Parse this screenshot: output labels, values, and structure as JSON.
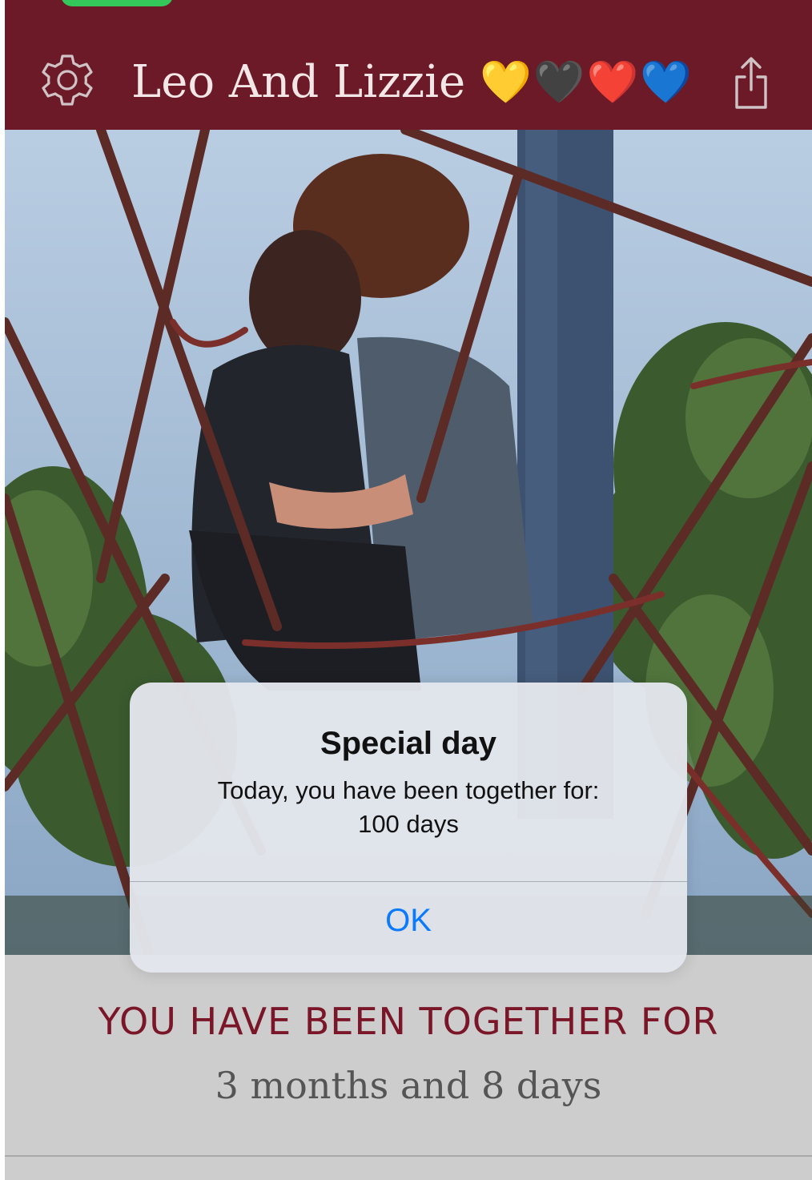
{
  "header": {
    "title": "Leo And Lizzie",
    "hearts": "💛🖤❤️💙",
    "left_icon": "gear-icon",
    "right_icon": "share-icon",
    "background_color": "#6c1a27"
  },
  "photo": {
    "description_icon": "couple-photo"
  },
  "counter": {
    "label": "YOU HAVE BEEN TOGETHER FOR",
    "value": "3 months and 8 days",
    "label_color": "#7a1627"
  },
  "alert": {
    "title": "Special day",
    "message_line1": "Today, you have been together for:",
    "message_line2": "100 days",
    "ok_label": "OK",
    "ok_color": "#0a7aff"
  }
}
